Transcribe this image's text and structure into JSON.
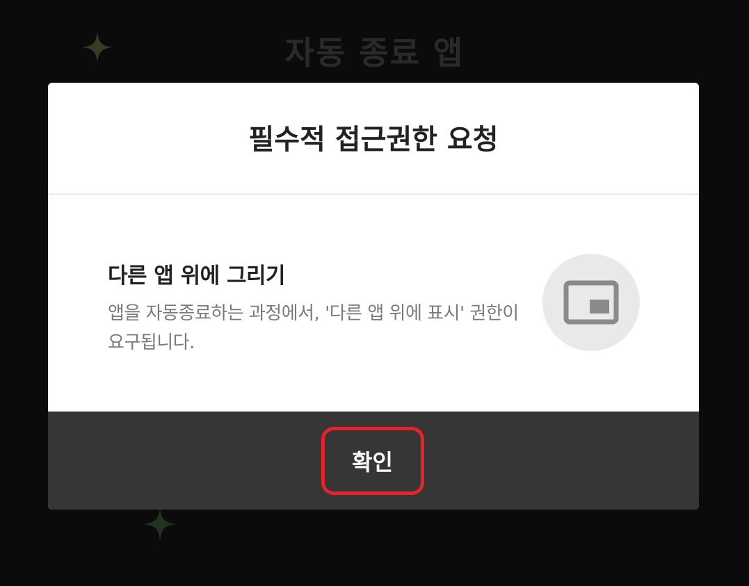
{
  "background": {
    "app_title": "자동 종료 앱"
  },
  "dialog": {
    "title": "필수적 접근권한 요청",
    "permission": {
      "title": "다른 앱 위에 그리기",
      "description_line1": "앱을 자동종료하는 과정에서, '다른 앱 위에 표시' 권한이",
      "description_line2": "요구됩니다.",
      "icon": "picture-in-picture-icon"
    },
    "confirm_label": "확인"
  },
  "colors": {
    "background": "#0b0b0b",
    "dialog": "#ffffff",
    "footer": "#363636",
    "highlight": "#e8222b",
    "sparkle_gold": "#3c3a24",
    "sparkle_green": "#1f3322"
  }
}
